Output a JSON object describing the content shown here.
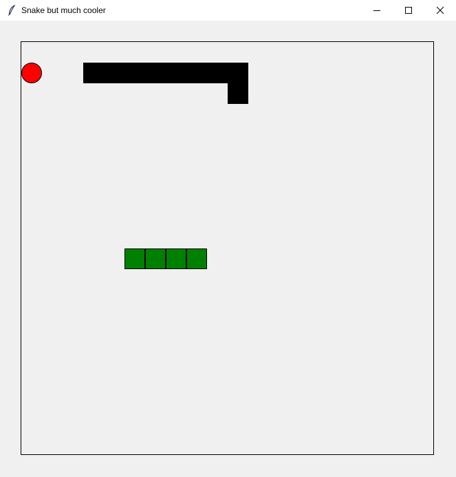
{
  "window": {
    "title": "Snake but much cooler",
    "app_icon": "feather-icon",
    "controls": [
      {
        "name": "minimize-button",
        "icon": "minimize-icon"
      },
      {
        "name": "maximize-button",
        "icon": "maximize-icon"
      },
      {
        "name": "close-button",
        "icon": "close-icon"
      }
    ]
  },
  "game": {
    "grid_cell_count": 20,
    "food": {
      "col": 0,
      "row": 1,
      "color": "#ff0000"
    },
    "black_snake": {
      "color": "#000000",
      "cells": [
        {
          "col": 3,
          "row": 1
        },
        {
          "col": 4,
          "row": 1
        },
        {
          "col": 5,
          "row": 1
        },
        {
          "col": 6,
          "row": 1
        },
        {
          "col": 7,
          "row": 1
        },
        {
          "col": 8,
          "row": 1
        },
        {
          "col": 9,
          "row": 1
        },
        {
          "col": 10,
          "row": 1
        },
        {
          "col": 10,
          "row": 2
        }
      ]
    },
    "green_snake": {
      "color": "#008000",
      "cells": [
        {
          "col": 5,
          "row": 10
        },
        {
          "col": 6,
          "row": 10
        },
        {
          "col": 7,
          "row": 10
        },
        {
          "col": 8,
          "row": 10
        }
      ]
    }
  }
}
